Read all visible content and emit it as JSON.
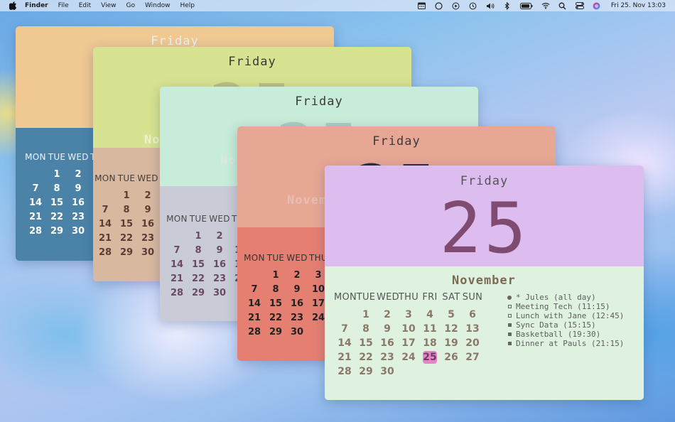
{
  "menubar": {
    "app": "Finder",
    "menus": [
      "File",
      "Edit",
      "View",
      "Go",
      "Window",
      "Help"
    ],
    "clock": "Fri 25. Nov  13:03",
    "status_icons": [
      "calendar-icon",
      "circle-icon",
      "play-icon",
      "time-machine-icon",
      "volume-icon",
      "bluetooth-icon",
      "battery-icon",
      "wifi-icon",
      "search-icon",
      "control-center-icon",
      "siri-icon"
    ]
  },
  "weekdays": [
    "MON",
    "TUE",
    "WED",
    "THU",
    "FRI",
    "SAT",
    "SUN"
  ],
  "widget": {
    "dayname": "Friday",
    "daynum": "25",
    "month": "November"
  },
  "calendar_rows": [
    [
      "",
      "1",
      "2",
      "3",
      "4",
      "5",
      "6"
    ],
    [
      "7",
      "8",
      "9",
      "10",
      "11",
      "12",
      "13"
    ],
    [
      "14",
      "15",
      "16",
      "17",
      "18",
      "19",
      "20"
    ],
    [
      "21",
      "22",
      "23",
      "24",
      "25",
      "26",
      "27"
    ],
    [
      "28",
      "29",
      "30",
      "",
      "",
      "",
      ""
    ]
  ],
  "events": [
    {
      "marker": "dot",
      "text": "* Jules (all day)"
    },
    {
      "marker": "open",
      "text": "Meeting Tech (11:15)"
    },
    {
      "marker": "open",
      "text": "Lunch with Jane (12:45)"
    },
    {
      "marker": "filled",
      "text": "Sync Data (15:15)"
    },
    {
      "marker": "filled",
      "text": "Basketball (19:30)"
    },
    {
      "marker": "filled",
      "text": "Dinner at Pauls (21:15)"
    }
  ],
  "colors": {
    "w1_top": "#f0c892",
    "w1_bottom": "#4b83a8",
    "w2_top": "#d7e390",
    "w2_bottom": "#d9b8a0",
    "w3_top": "#c7ecd9",
    "w3_bottom": "#c9ccd6",
    "w4_top": "#e7a795",
    "w4_bottom": "#e57f72",
    "w5_top": "#ddbcf0",
    "w5_bottom": "#dff2df",
    "today_highlight": "#e584c9"
  }
}
